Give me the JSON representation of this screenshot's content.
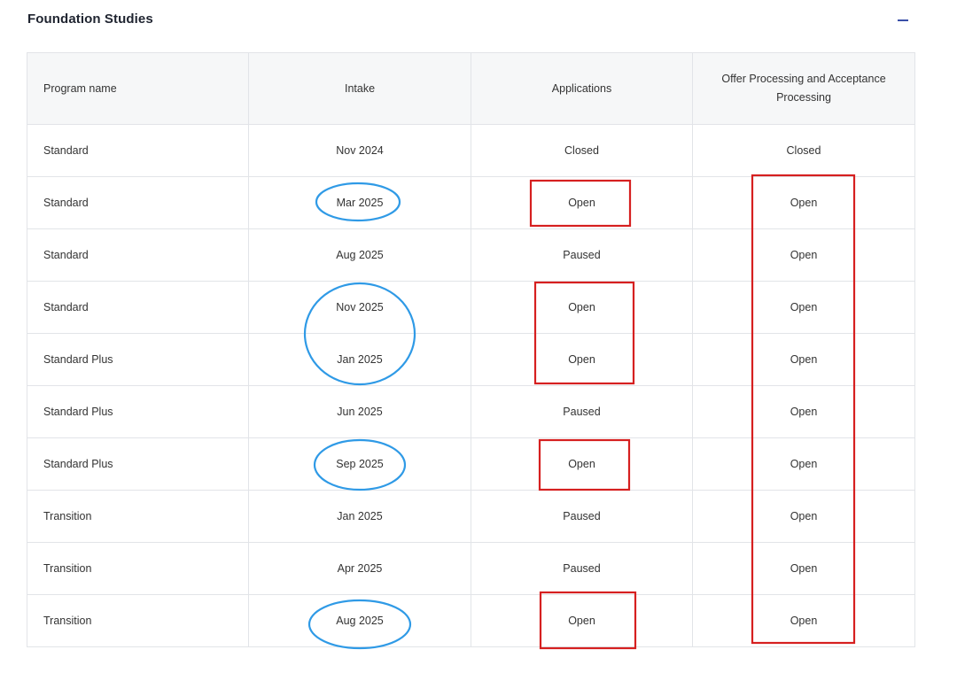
{
  "section": {
    "title": "Foundation Studies",
    "toggle_icon": "minus-icon"
  },
  "table": {
    "headers": {
      "program_name": "Program name",
      "intake": "Intake",
      "applications": "Applications",
      "offer_processing": "Offer Processing and Acceptance Processing"
    },
    "rows": [
      {
        "program": "Standard",
        "intake": "Nov 2024",
        "applications": "Closed",
        "offer": "Closed"
      },
      {
        "program": "Standard",
        "intake": "Mar 2025",
        "applications": "Open",
        "offer": "Open"
      },
      {
        "program": "Standard",
        "intake": "Aug 2025",
        "applications": "Paused",
        "offer": "Open"
      },
      {
        "program": "Standard",
        "intake": "Nov 2025",
        "applications": "Open",
        "offer": "Open"
      },
      {
        "program": "Standard Plus",
        "intake": "Jan 2025",
        "applications": "Open",
        "offer": "Open"
      },
      {
        "program": "Standard Plus",
        "intake": "Jun 2025",
        "applications": "Paused",
        "offer": "Open"
      },
      {
        "program": "Standard Plus",
        "intake": "Sep 2025",
        "applications": "Open",
        "offer": "Open"
      },
      {
        "program": "Transition",
        "intake": "Jan 2025",
        "applications": "Paused",
        "offer": "Open"
      },
      {
        "program": "Transition",
        "intake": "Apr 2025",
        "applications": "Paused",
        "offer": "Open"
      },
      {
        "program": "Transition",
        "intake": "Aug 2025",
        "applications": "Open",
        "offer": "Open"
      }
    ]
  },
  "annotation_colors": {
    "circle": "#2f9ae6",
    "box": "#d62020"
  }
}
